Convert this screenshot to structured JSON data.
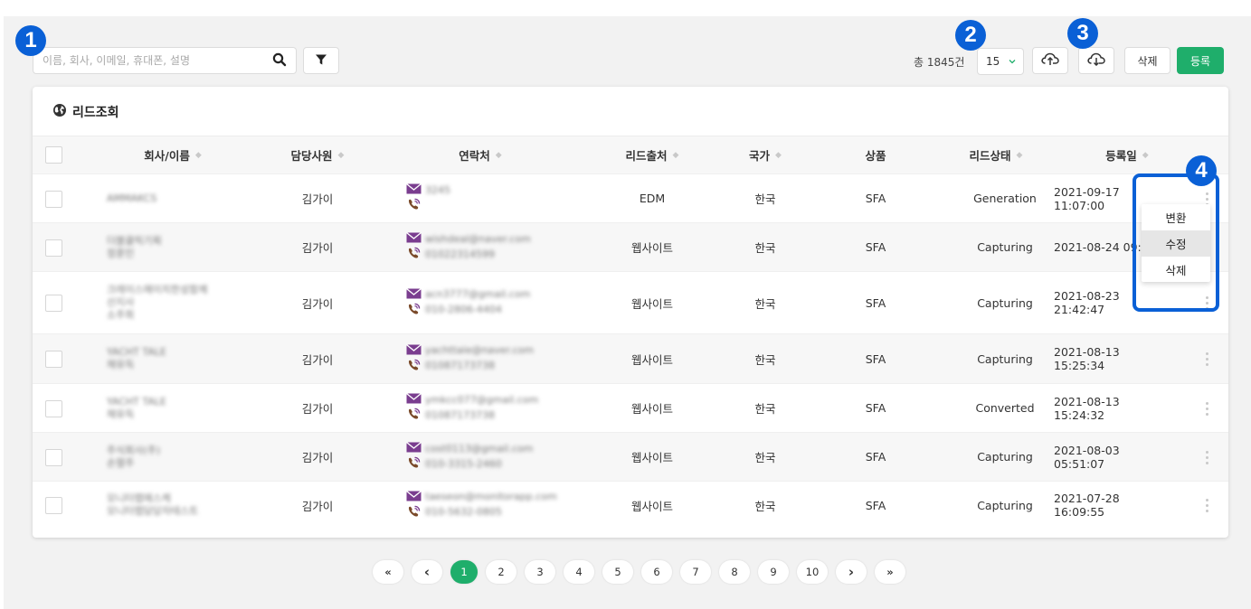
{
  "search": {
    "placeholder": "이름, 회사, 이메일, 휴대폰, 설명"
  },
  "toolbar": {
    "total_label": "총 1845건",
    "page_size": "15",
    "delete_label": "삭제",
    "register_label": "등록"
  },
  "badges": [
    "1",
    "2",
    "3",
    "4"
  ],
  "card": {
    "title": "리드조회"
  },
  "table": {
    "columns": [
      "회사/이름",
      "담당사원",
      "연락처",
      "리드출처",
      "국가",
      "상품",
      "리드상태",
      "등록일"
    ],
    "rows": [
      {
        "name": "AMMAKCS",
        "owner": "김가이",
        "email": "3245",
        "phone": "",
        "source": "EDM",
        "country": "한국",
        "product": "SFA",
        "status": "Generation",
        "date": "2021-09-17 11:07:00"
      },
      {
        "name": "더블클릭기획\n정훈민",
        "owner": "김가이",
        "email": "wishdeal@naver.com",
        "phone": "01022314599",
        "source": "웹사이트",
        "country": "한국",
        "product": "SFA",
        "status": "Capturing",
        "date": "2021-08-24 09:"
      },
      {
        "name": "크레이스에이치한성함께\n산지사\n소주희",
        "owner": "김가이",
        "email": "acn3777@gmail.com",
        "phone": "010-2806-4404",
        "source": "웹사이트",
        "country": "한국",
        "product": "SFA",
        "status": "Capturing",
        "date": "2021-08-23 21:42:47"
      },
      {
        "name": "YACHT TALE\n채유득",
        "owner": "김가이",
        "email": "yachttale@naver.com",
        "phone": "01087173738",
        "source": "웹사이트",
        "country": "한국",
        "product": "SFA",
        "status": "Capturing",
        "date": "2021-08-13 15:25:34"
      },
      {
        "name": "YACHT TALE\n채유득",
        "owner": "김가이",
        "email": "ymkcc077@gmail.com",
        "phone": "01087173738",
        "source": "웹사이트",
        "country": "한국",
        "product": "SFA",
        "status": "Converted",
        "date": "2021-08-13 15:24:32"
      },
      {
        "name": "주식회사(주)\n손렬주",
        "owner": "김가이",
        "email": "cost0113@gmail.com",
        "phone": "010-3315-2460",
        "source": "웹사이트",
        "country": "한국",
        "product": "SFA",
        "status": "Capturing",
        "date": "2021-08-03 05:51:07"
      },
      {
        "name": "모니터랩에스케\n모니터랩담당자테스트",
        "owner": "김가이",
        "email": "taeseon@monitorapp.com",
        "phone": "010-5632-0805",
        "source": "웹사이트",
        "country": "한국",
        "product": "SFA",
        "status": "Capturing",
        "date": "2021-07-28 16:09:55"
      }
    ]
  },
  "row_menu": {
    "items": [
      "변환",
      "수정",
      "삭제"
    ],
    "active": "수정"
  },
  "pagination": {
    "first": "«",
    "prev": "‹",
    "pages": [
      "1",
      "2",
      "3",
      "4",
      "5",
      "6",
      "7",
      "8",
      "9",
      "10"
    ],
    "current": "1",
    "next": "›",
    "last": "»"
  },
  "colors": {
    "accent": "#1fae6b",
    "callout": "#0a60d6",
    "background": "#f2f2f2"
  }
}
